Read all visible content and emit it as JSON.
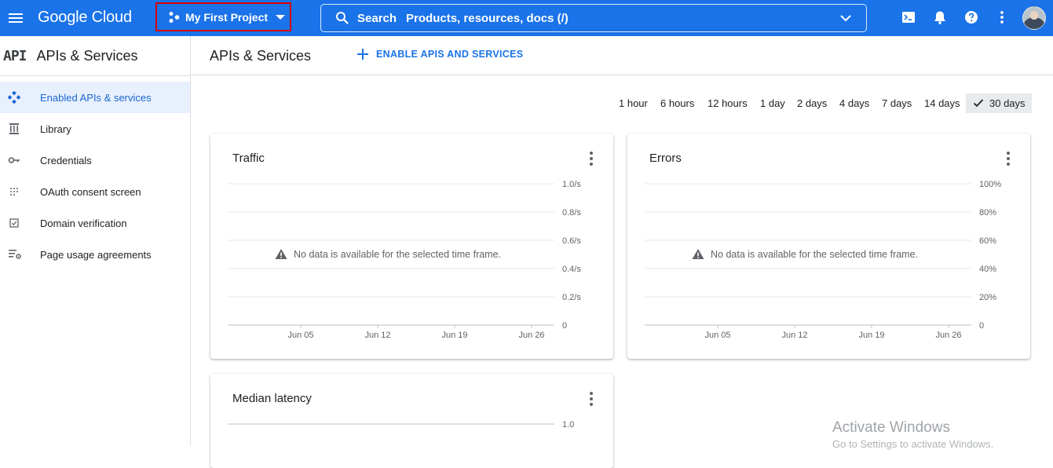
{
  "topbar": {
    "logo": "Google Cloud",
    "project": "My First Project",
    "search_label": "Search",
    "search_placeholder": "Products, resources, docs (/)"
  },
  "sidebar": {
    "badge": "API",
    "title": "APIs & Services",
    "items": [
      {
        "label": "Enabled APIs & services",
        "icon": "diamond-nodes-icon",
        "active": true
      },
      {
        "label": "Library",
        "icon": "library-icon",
        "active": false
      },
      {
        "label": "Credentials",
        "icon": "key-icon",
        "active": false
      },
      {
        "label": "OAuth consent screen",
        "icon": "dotted-grid-icon",
        "active": false
      },
      {
        "label": "Domain verification",
        "icon": "checkbox-icon",
        "active": false
      },
      {
        "label": "Page usage agreements",
        "icon": "list-settings-icon",
        "active": false
      }
    ]
  },
  "main": {
    "title": "APIs & Services",
    "enable_button": "ENABLE APIS AND SERVICES",
    "timeframes": [
      "1 hour",
      "6 hours",
      "12 hours",
      "1 day",
      "2 days",
      "4 days",
      "7 days",
      "14 days",
      "30 days"
    ],
    "selected_timeframe": "30 days"
  },
  "cards": {
    "traffic": {
      "title": "Traffic",
      "no_data": "No data is available for the selected time frame.",
      "y_ticks": [
        "1.0/s",
        "0.8/s",
        "0.6/s",
        "0.4/s",
        "0.2/s",
        "0"
      ],
      "x_ticks": [
        "Jun 05",
        "Jun 12",
        "Jun 19",
        "Jun 26"
      ]
    },
    "errors": {
      "title": "Errors",
      "no_data": "No data is available for the selected time frame.",
      "y_ticks": [
        "100%",
        "80%",
        "60%",
        "40%",
        "20%",
        "0"
      ],
      "x_ticks": [
        "Jun 05",
        "Jun 12",
        "Jun 19",
        "Jun 26"
      ]
    },
    "latency": {
      "title": "Median latency",
      "y_ticks": [
        "1.0"
      ]
    }
  },
  "watermark": {
    "title": "Activate Windows",
    "subtitle": "Go to Settings to activate Windows."
  },
  "colors": {
    "brand": "#1a73e8",
    "active_bg": "#e8f0fe",
    "highlight_border": "#d50000"
  }
}
